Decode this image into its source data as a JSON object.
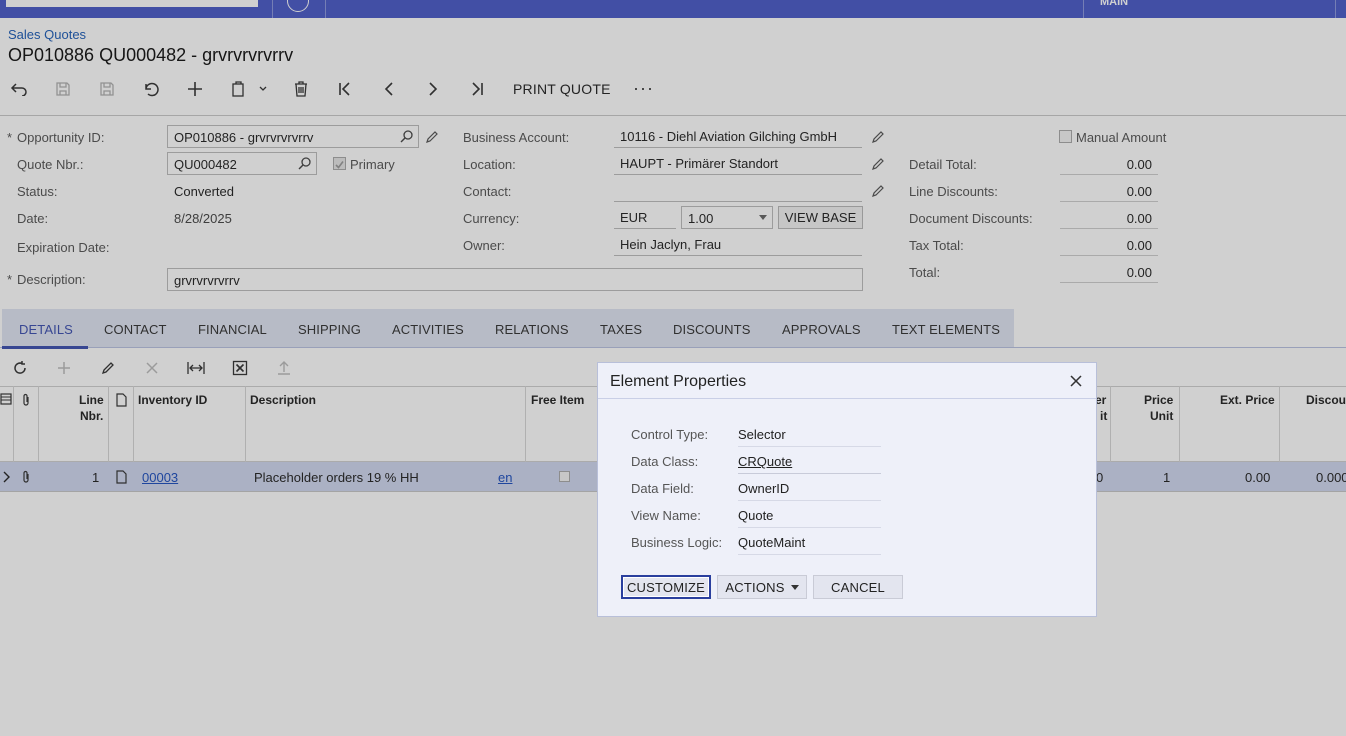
{
  "topbar": {
    "right_label": "MAIN"
  },
  "breadcrumb": "Sales Quotes",
  "page_title": "OP010886 QU000482 - grvrvrvrvrrv",
  "toolbar": {
    "print_quote": "PRINT QUOTE",
    "more": "···"
  },
  "form": {
    "opportunity_id_label": "Opportunity ID:",
    "opportunity_id_value": "OP010886 - grvrvrvrvrrv",
    "quote_nbr_label": "Quote Nbr.:",
    "quote_nbr_value": "QU000482",
    "primary_label": "Primary",
    "status_label": "Status:",
    "status_value": "Converted",
    "date_label": "Date:",
    "date_value": "8/28/2025",
    "expiration_label": "Expiration Date:",
    "description_label": "Description:",
    "description_value": "grvrvrvrvrrv",
    "business_account_label": "Business Account:",
    "business_account_value": "10116 - Diehl Aviation Gilching GmbH",
    "location_label": "Location:",
    "location_value": "HAUPT - Primärer Standort",
    "contact_label": "Contact:",
    "currency_label": "Currency:",
    "currency_value": "EUR",
    "rate_value": "1.00",
    "view_base": "VIEW BASE",
    "owner_label": "Owner:",
    "owner_value": "Hein Jaclyn, Frau",
    "manual_amount_label": "Manual Amount",
    "detail_total_label": "Detail Total:",
    "detail_total_value": "0.00",
    "line_discounts_label": "Line Discounts:",
    "line_discounts_value": "0.00",
    "document_discounts_label": "Document Discounts:",
    "document_discounts_value": "0.00",
    "tax_total_label": "Tax Total:",
    "tax_total_value": "0.00",
    "total_label": "Total:",
    "total_value": "0.00",
    "required_marker": "*"
  },
  "tabs": [
    "DETAILS",
    "CONTACT",
    "FINANCIAL",
    "SHIPPING",
    "ACTIVITIES",
    "RELATIONS",
    "TAXES",
    "DISCOUNTS",
    "APPROVALS",
    "TEXT ELEMENTS"
  ],
  "grid": {
    "headers": {
      "line_nbr_1": "Line",
      "line_nbr_2": "Nbr.",
      "inventory_id": "Inventory ID",
      "description": "Description",
      "free_item": "Free Item",
      "uom_partial": "er",
      "uom_partial_2": "it",
      "price_unit_1": "Price",
      "price_unit_2": "Unit",
      "ext_price": "Ext. Price",
      "discount": "Discou"
    },
    "row": {
      "line_nbr": "1",
      "inventory_id": "00003",
      "description": "Placeholder orders 19 % HH",
      "lang": "en",
      "hidden_partial": "0",
      "price_unit": "1",
      "ext_price": "0.00",
      "discount": "0.000"
    }
  },
  "dialog": {
    "title": "Element Properties",
    "control_type_label": "Control Type:",
    "control_type_value": "Selector",
    "data_class_label": "Data Class:",
    "data_class_value": "CRQuote",
    "data_field_label": "Data Field:",
    "data_field_value": "OwnerID",
    "view_name_label": "View Name:",
    "view_name_value": "Quote",
    "business_logic_label": "Business Logic:",
    "business_logic_value": "QuoteMaint",
    "customize": "CUSTOMIZE",
    "actions": "ACTIONS",
    "cancel": "CANCEL"
  }
}
